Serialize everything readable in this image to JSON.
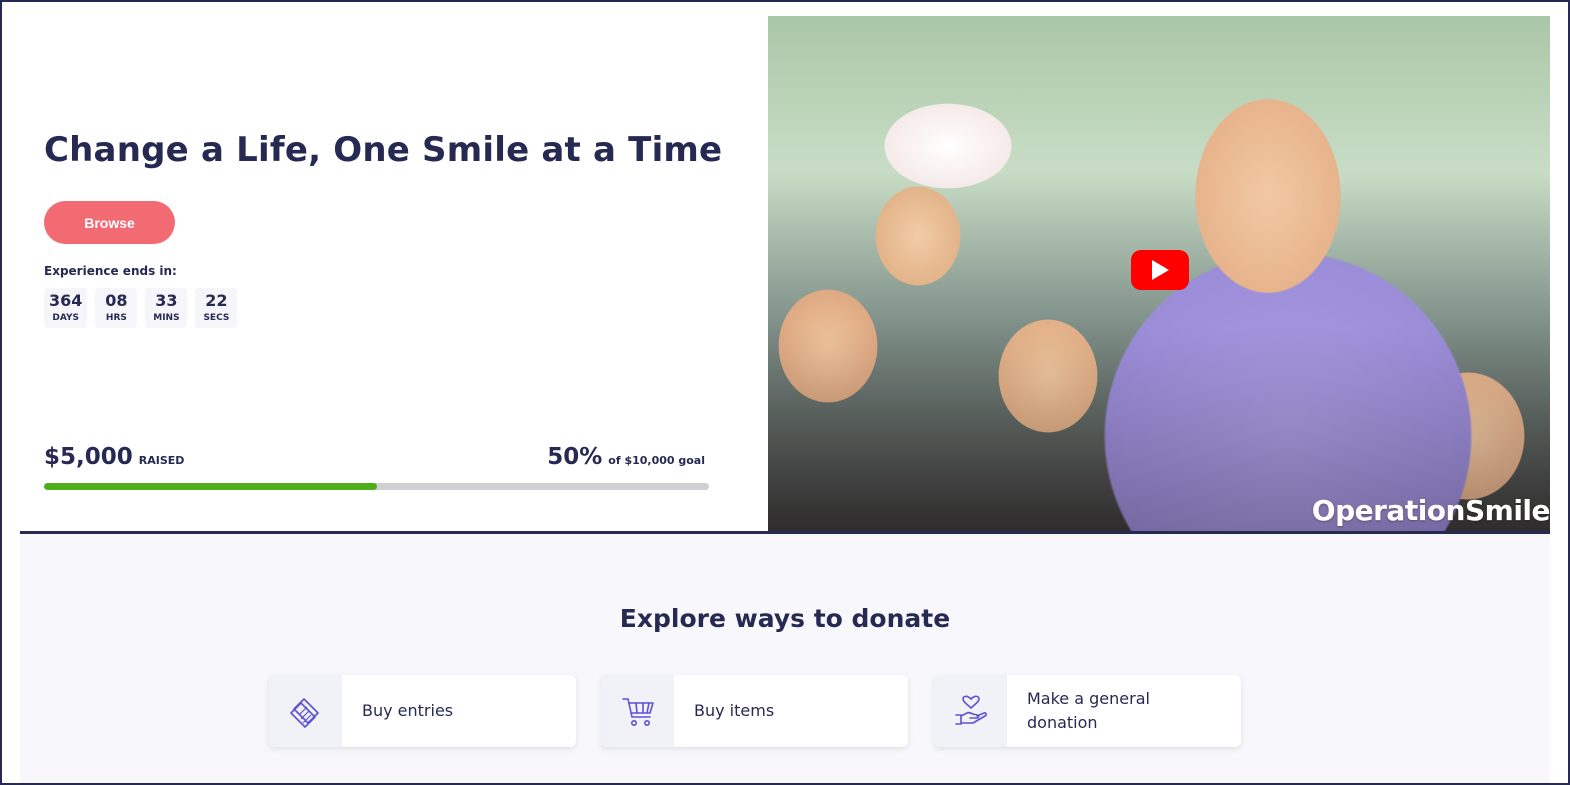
{
  "hero": {
    "title": "Change a Life, One Smile at a Time",
    "browse_label": "Browse",
    "countdown_label": "Experience ends in:",
    "countdown": [
      {
        "value": "364",
        "unit": "DAYS"
      },
      {
        "value": "08",
        "unit": "HRS"
      },
      {
        "value": "33",
        "unit": "MINS"
      },
      {
        "value": "22",
        "unit": "SECS"
      }
    ],
    "raised_amount": "$5,000",
    "raised_label": "RAISED",
    "goal_percent": "50%",
    "goal_text": "of $10,000 goal",
    "progress_fraction": 0.5
  },
  "video": {
    "watermark": "OperationSmile",
    "play_icon": "youtube-play-icon"
  },
  "explore": {
    "title": "Explore ways to donate",
    "options": [
      {
        "label": "Buy entries",
        "icon": "tickets-icon"
      },
      {
        "label": "Buy items",
        "icon": "cart-icon"
      },
      {
        "label": "Make a general donation",
        "icon": "donation-hand-heart-icon"
      }
    ]
  },
  "colors": {
    "navy": "#262a52",
    "browse_button": "#f26b72",
    "progress_fill": "#4caf1a",
    "progress_track": "#cfcfd4",
    "icon_purple": "#5b52d6",
    "youtube_red": "#ff0000"
  }
}
